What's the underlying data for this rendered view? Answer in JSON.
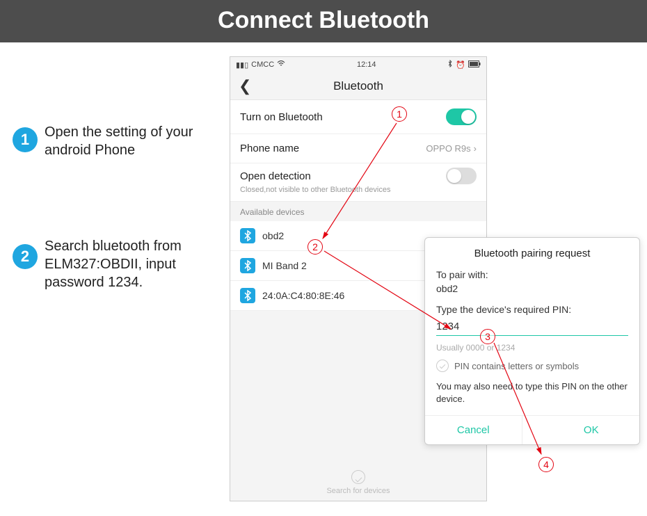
{
  "header": {
    "title": "Connect Bluetooth"
  },
  "steps": [
    {
      "num": "1",
      "text": "Open the setting of your android Phone"
    },
    {
      "num": "2",
      "text": "Search bluetooth from ELM327:OBDII, input password 1234."
    }
  ],
  "phone": {
    "status": {
      "carrier": "CMCC",
      "time": "12:14"
    },
    "nav_title": "Bluetooth",
    "rows": {
      "turn_on": "Turn on Bluetooth",
      "phone_name_label": "Phone name",
      "phone_name_value": "OPPO R9s",
      "open_detection": "Open detection",
      "open_detection_sub": "Closed,not visible to other Bluetooth devices"
    },
    "available_header": "Available devices",
    "devices": [
      {
        "name": "obd2"
      },
      {
        "name": "MI Band 2"
      },
      {
        "name": "24:0A:C4:80:8E:46"
      }
    ],
    "search_footer": "Search for devices"
  },
  "dialog": {
    "title": "Bluetooth pairing request",
    "to_pair_label": "To pair with:",
    "device": "obd2",
    "pin_label": "Type the device's required PIN:",
    "pin_value": "1234",
    "hint": "Usually 0000 or 1234",
    "checkbox_label": "PIN contains letters or symbols",
    "note": "You may also need to type this PIN on the other device.",
    "cancel": "Cancel",
    "ok": "OK"
  },
  "markers": {
    "m1": "1",
    "m2": "2",
    "m3": "3",
    "m4": "4"
  }
}
